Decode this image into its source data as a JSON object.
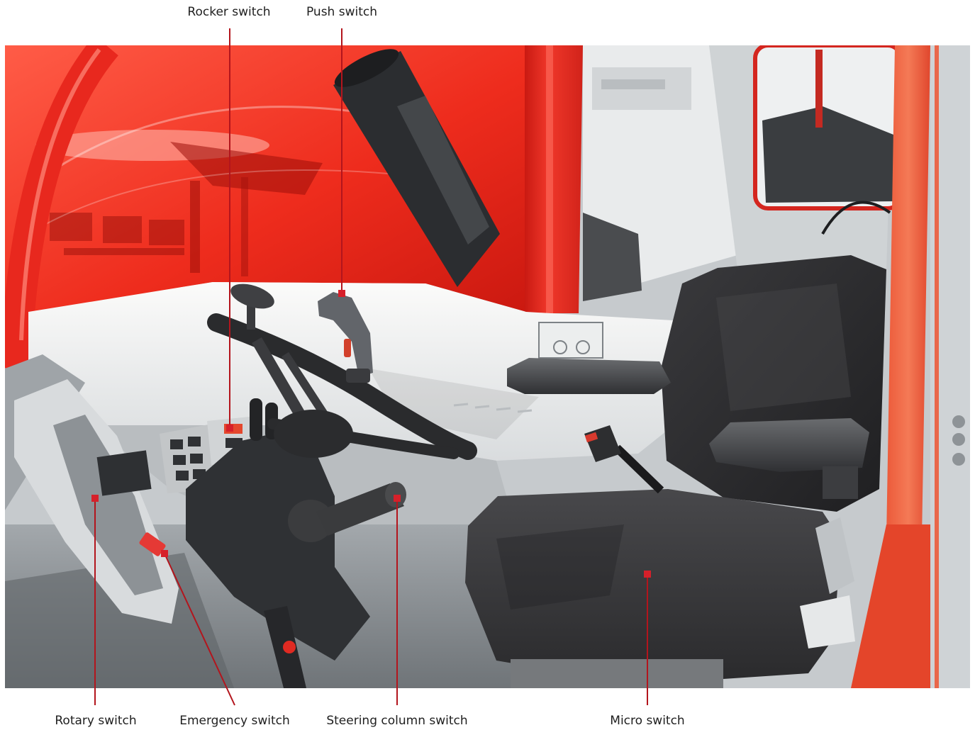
{
  "figure": {
    "callouts": {
      "rocker_switch": {
        "label": "Rocker switch"
      },
      "push_switch": {
        "label": "Push switch"
      },
      "rotary_switch": {
        "label": "Rotary switch"
      },
      "emergency_switch": {
        "label": "Emergency switch"
      },
      "steering_column_switch": {
        "label": "Steering column switch"
      },
      "micro_switch": {
        "label": "Micro switch"
      }
    },
    "colors": {
      "callout_line": "#b3151d",
      "callout_marker": "#d6202a",
      "label_text": "#1f1f1f",
      "cab_frame": "#e3261d",
      "seat_fabric": "#2c2c2e"
    }
  }
}
